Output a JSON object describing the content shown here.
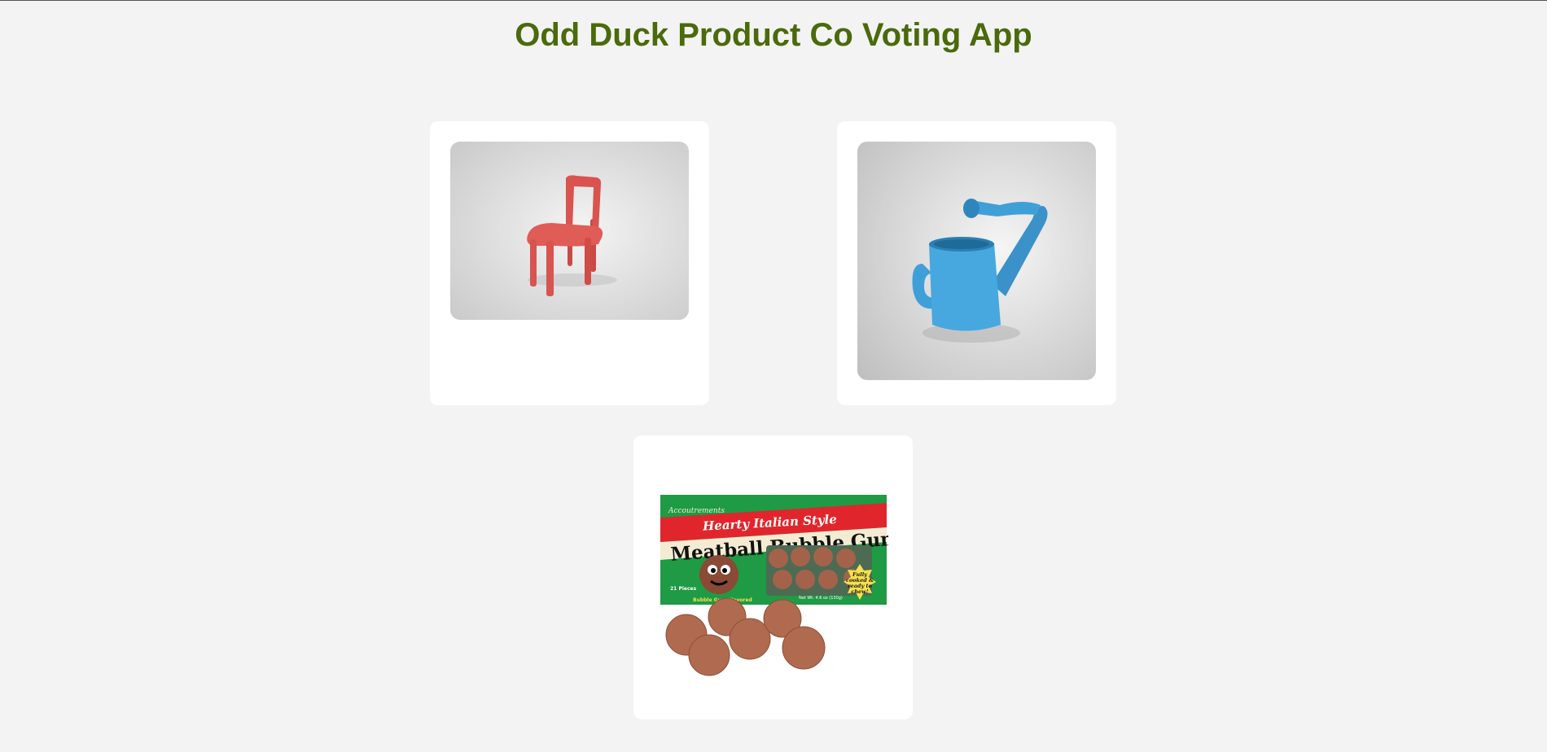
{
  "app": {
    "title": "Odd Duck Product Co Voting App"
  },
  "products": [
    {
      "name": "chair",
      "icon": "red-chair-image"
    },
    {
      "name": "water-can",
      "icon": "blue-watering-can-image"
    },
    {
      "name": "bubblegum",
      "icon": "meatball-bubble-gum-image",
      "package": {
        "brand": "Accoutrements",
        "tagline": "Hearty Italian Style",
        "product_name": "Meatball Bubble Gum",
        "pieces": "21 Pieces",
        "flavor": "Bubble Gum Flavored",
        "burst": [
          "Fully",
          "cooked &",
          "ready to",
          "chew!"
        ],
        "net_weight": "Net Wt. 4.6 oz (130g)"
      }
    }
  ],
  "colors": {
    "title": "#4a6a0b",
    "background": "#f3f3f3",
    "card": "#ffffff",
    "chair": "#d9534f",
    "watering_can": "#3fa0d8",
    "gum_box_green": "#1f9a45",
    "gum_box_red": "#e0262c"
  }
}
